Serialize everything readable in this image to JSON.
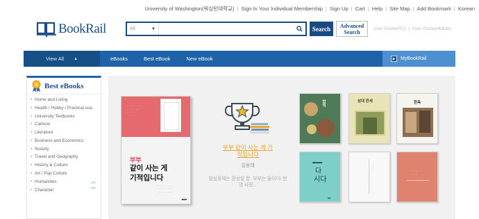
{
  "util_nav": {
    "institution": "University of Washington(워싱턴대학교)",
    "sign_in": "Sign In Your Individual Membership",
    "sign_up": "Sign Up",
    "cart": "Cart",
    "help": "Help",
    "site_map": "Site Map",
    "add_bookmark": "Add Bookmark",
    "language": "Korean"
  },
  "logo": {
    "text": "BookRail"
  },
  "search": {
    "scope": "All",
    "value": "",
    "button_label": "Search",
    "advanced_label_1": "Advanced",
    "advanced_label_2": "Search"
  },
  "guides": {
    "pc": "User Guide(PC)",
    "mobile": "User Guide(Mobile)"
  },
  "main_nav": {
    "view_all": "View All",
    "items": [
      "eBooks",
      "Best eBook",
      "New eBook"
    ],
    "my_bookrail": "MyBookRail"
  },
  "sidebar": {
    "title": "Best eBooks",
    "categories": [
      "Home and Living",
      "Health / Hobby / Practical use",
      "University Textbooks",
      "Cartoon",
      "Literature",
      "Business and Economics",
      "Society",
      "Travel and Geography",
      "History & Culture",
      "Art / Pop Culture",
      "Humanities",
      "Character"
    ]
  },
  "featured": {
    "cover_subtitle": "부부",
    "cover_title_1": "같이 사는 게",
    "cover_title_2": "기적입니다",
    "title_line_1": "부부 같이 사는 게 기",
    "title_line_2": "적입니다",
    "author": "김용태",
    "description": "일심동체는 환상일 뿐, 부부는 둘이다! 분명 사랑..."
  },
  "grid_books": [
    {
      "title": "밥먹",
      "color": "#4f7a57"
    },
    {
      "title": "삼대 한세",
      "color": "#e9e4b8"
    },
    {
      "title": "한옥",
      "color": "#f6f4ef"
    },
    {
      "title_1": "다",
      "title_2": "시다",
      "color": "#7fcfc9"
    },
    {
      "title": "",
      "color": "#f8f8f8"
    },
    {
      "title": "",
      "color": "#e0836e"
    }
  ],
  "colors": {
    "brand": "#1b4a82",
    "nav_bar": "#1e63a7",
    "accent_orange": "#f0a228",
    "featured_cover": "#e46a6f"
  },
  "icons": [
    "book-logo-icon",
    "search-icon",
    "caret-down-icon",
    "medal-icon",
    "trophy-icon",
    "chevron-up-icon",
    "chevron-down-icon"
  ]
}
